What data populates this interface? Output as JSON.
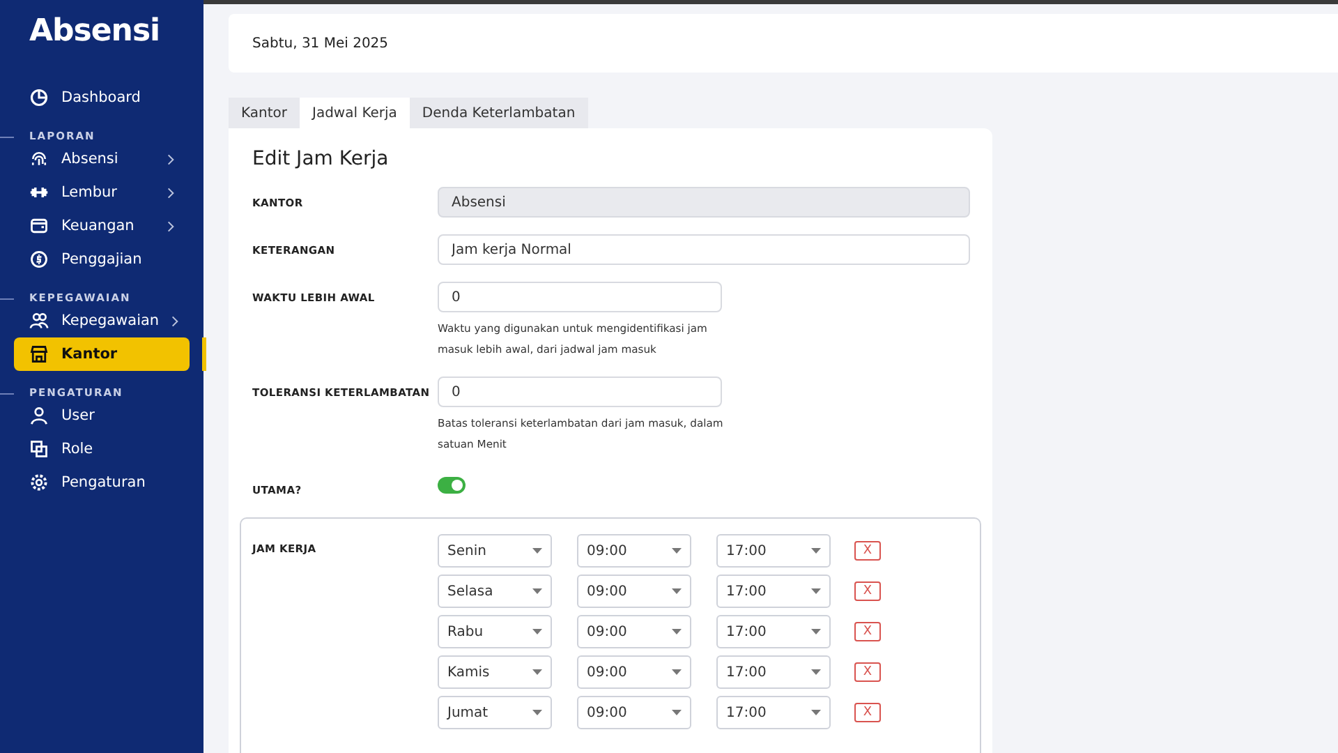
{
  "sidebar": {
    "logo": "Absensi",
    "items": [
      {
        "kind": "item",
        "label": "Dashboard",
        "submenu": false,
        "selected": false
      },
      {
        "kind": "section",
        "label": "LAPORAN"
      },
      {
        "kind": "item",
        "label": "Absensi",
        "submenu": true,
        "selected": false
      },
      {
        "kind": "item",
        "label": "Lembur",
        "submenu": true,
        "selected": false
      },
      {
        "kind": "item",
        "label": "Keuangan",
        "submenu": true,
        "selected": false
      },
      {
        "kind": "item",
        "label": "Penggajian",
        "submenu": false,
        "selected": false
      },
      {
        "kind": "section",
        "label": "KEPEGAWAIAN"
      },
      {
        "kind": "item",
        "label": "Kepegawaian",
        "submenu": true,
        "selected": false
      },
      {
        "kind": "item",
        "label": "Kantor",
        "submenu": false,
        "selected": true
      },
      {
        "kind": "section",
        "label": "PENGATURAN"
      },
      {
        "kind": "item",
        "label": "User",
        "submenu": false,
        "selected": false
      },
      {
        "kind": "item",
        "label": "Role",
        "submenu": false,
        "selected": false
      },
      {
        "kind": "item",
        "label": "Pengaturan",
        "submenu": false,
        "selected": false
      }
    ]
  },
  "header": {
    "date": "Sabtu, 31 Mei 2025"
  },
  "tabs": [
    {
      "label": "Kantor",
      "selected": false
    },
    {
      "label": "Jadwal Kerja",
      "selected": true
    },
    {
      "label": "Denda Keterlambatan",
      "selected": false
    }
  ],
  "form": {
    "title": "Edit Jam Kerja",
    "fields": [
      {
        "kind": "readonly",
        "label": "KANTOR",
        "value": "Absensi"
      },
      {
        "kind": "text",
        "label": "KETERANGAN",
        "value": "Jam kerja Normal"
      },
      {
        "kind": "number",
        "label": "WAKTU LEBIH AWAL",
        "value": "0",
        "help": "Waktu yang digunakan untuk mengidentifikasi jam masuk lebih awal, dari jadwal jam masuk"
      },
      {
        "kind": "number",
        "label": "TOLERANSI KETERLAMBATAN",
        "value": "0",
        "help": "Batas toleransi keterlambatan dari jam masuk, dalam satuan Menit"
      },
      {
        "kind": "toggle",
        "label": "UTAMA?",
        "on": true
      }
    ],
    "schedule": {
      "label": "JAM KERJA",
      "rows": [
        {
          "day": "Senin",
          "start": "09:00",
          "end": "17:00",
          "remove": "X"
        },
        {
          "day": "Selasa",
          "start": "09:00",
          "end": "17:00",
          "remove": "X"
        },
        {
          "day": "Rabu",
          "start": "09:00",
          "end": "17:00",
          "remove": "X"
        },
        {
          "day": "Kamis",
          "start": "09:00",
          "end": "17:00",
          "remove": "X"
        },
        {
          "day": "Jumat",
          "start": "09:00",
          "end": "17:00",
          "remove": "X"
        }
      ]
    }
  }
}
